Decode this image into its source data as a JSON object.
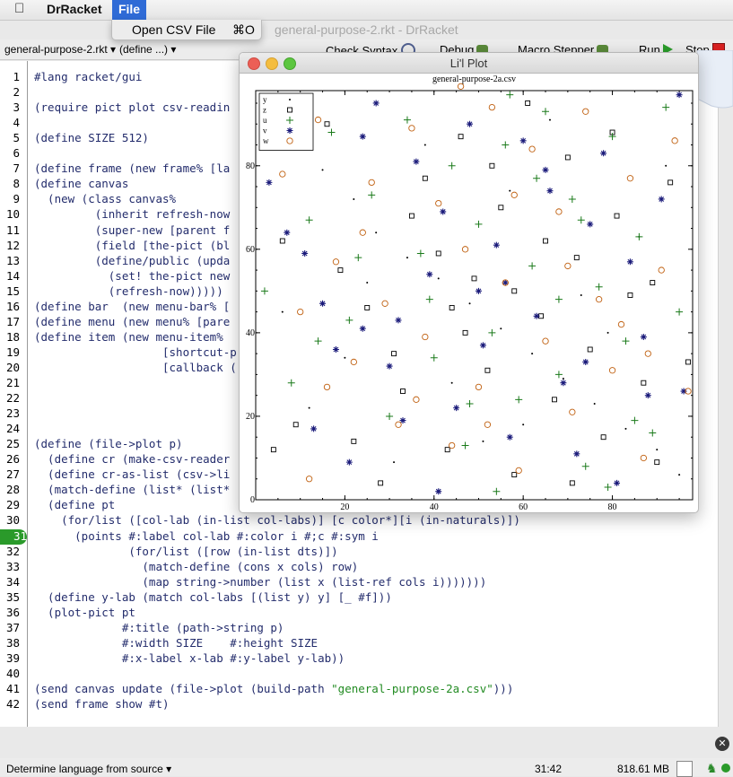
{
  "menubar": {
    "apple_icon": "apple-logo-icon",
    "app_name": "DrRacket",
    "file_menu": "File"
  },
  "dropdown": {
    "item_label": "Open CSV File",
    "shortcut": "⌘O"
  },
  "window": {
    "title": "general-purpose-2.rkt - DrRacket"
  },
  "toolbar": {
    "file_selector": "general-purpose-2.rkt ▾",
    "define_selector": "(define ...) ▾",
    "check_syntax": "Check Syntax",
    "debug": "Debug",
    "macro_stepper": "Macro Stepper",
    "run": "Run",
    "stop": "Stop"
  },
  "editor": {
    "active_line": 31,
    "lines": [
      "#lang racket/gui",
      "",
      "(require pict plot csv-readin",
      "",
      "(define SIZE 512)",
      "",
      "(define frame (new frame% [la",
      "(define canvas",
      "  (new (class canvas%",
      "         (inherit refresh-now",
      "         (super-new [parent f",
      "         (field [the-pict (bl",
      "         (define/public (upda",
      "           (set! the-pict new",
      "           (refresh-now)))))",
      "(define bar  (new menu-bar% [",
      "(define menu (new menu% [pare",
      "(define item (new menu-item%",
      "                   [shortcut-p",
      "                   [callback (",
      "",
      "",
      "",
      "",
      "(define (file->plot p)",
      "  (define cr (make-csv-reader",
      "  (define cr-as-list (csv->li",
      "  (match-define (list* (list*",
      "  (define pt",
      "    (for/list ([col-lab (in-list col-labs)] [c color*][i (in-naturals)])",
      "      (points #:label col-lab #:color i #;c #:sym i",
      "              (for/list ([row (in-list dts)])",
      "                (match-define (cons x cols) row)",
      "                (map string->number (list x (list-ref cols i)))))))",
      "  (define y-lab (match col-labs [(list y) y] [_ #f]))",
      "  (plot-pict pt",
      "             #:title (path->string p)",
      "             #:width SIZE    #:height SIZE",
      "             #:x-label x-lab #:y-label y-lab))",
      "",
      "(send canvas update (file->plot (build-path \"general-purpose-2a.csv\")))",
      "(send frame show #t)"
    ]
  },
  "plot_window": {
    "title": "Li'l Plot",
    "chart_data": {
      "type": "scatter",
      "title": "general-purpose-2a.csv",
      "xlabel": "",
      "ylabel": "",
      "xlim": [
        0,
        98
      ],
      "ylim": [
        0,
        98
      ],
      "x_ticks": [
        "20",
        "40",
        "60",
        "80"
      ],
      "y_ticks": [
        "0",
        "20",
        "40",
        "60",
        "80"
      ],
      "legend_position": "top-left",
      "series": [
        {
          "name": "y",
          "symbol": "dot",
          "color": "#000000",
          "points": [
            [
              3,
              88
            ],
            [
              9,
              85
            ],
            [
              15,
              79
            ],
            [
              22,
              72
            ],
            [
              27,
              64
            ],
            [
              34,
              58
            ],
            [
              41,
              53
            ],
            [
              48,
              47
            ],
            [
              55,
              41
            ],
            [
              62,
              35
            ],
            [
              69,
              29
            ],
            [
              76,
              23
            ],
            [
              83,
              17
            ],
            [
              90,
              12
            ],
            [
              95,
              6
            ],
            [
              12,
              22
            ],
            [
              20,
              34
            ],
            [
              31,
              9
            ],
            [
              44,
              28
            ],
            [
              57,
              74
            ],
            [
              66,
              91
            ],
            [
              73,
              49
            ],
            [
              86,
              63
            ],
            [
              38,
              85
            ],
            [
              51,
              14
            ],
            [
              79,
              40
            ],
            [
              92,
              80
            ],
            [
              6,
              45
            ],
            [
              25,
              52
            ],
            [
              60,
              18
            ]
          ]
        },
        {
          "name": "z",
          "symbol": "square",
          "color": "#000000",
          "points": [
            [
              6,
              62
            ],
            [
              9,
              18
            ],
            [
              19,
              55
            ],
            [
              25,
              46
            ],
            [
              31,
              35
            ],
            [
              33,
              26
            ],
            [
              38,
              77
            ],
            [
              41,
              59
            ],
            [
              43,
              12
            ],
            [
              46,
              87
            ],
            [
              49,
              53
            ],
            [
              52,
              31
            ],
            [
              55,
              70
            ],
            [
              58,
              6
            ],
            [
              61,
              95
            ],
            [
              64,
              44
            ],
            [
              67,
              24
            ],
            [
              70,
              82
            ],
            [
              72,
              58
            ],
            [
              75,
              36
            ],
            [
              78,
              15
            ],
            [
              81,
              68
            ],
            [
              84,
              49
            ],
            [
              87,
              28
            ],
            [
              90,
              9
            ],
            [
              93,
              76
            ],
            [
              28,
              4
            ],
            [
              35,
              68
            ],
            [
              47,
              40
            ],
            [
              53,
              80
            ],
            [
              65,
              62
            ],
            [
              16,
              90
            ],
            [
              22,
              14
            ],
            [
              80,
              88
            ],
            [
              89,
              52
            ],
            [
              97,
              33
            ],
            [
              4,
              12
            ],
            [
              44,
              46
            ],
            [
              58,
              50
            ],
            [
              71,
              4
            ]
          ]
        },
        {
          "name": "u",
          "symbol": "plus",
          "color": "#1a7a1a",
          "points": [
            [
              2,
              50
            ],
            [
              8,
              28
            ],
            [
              12,
              67
            ],
            [
              17,
              88
            ],
            [
              21,
              43
            ],
            [
              26,
              73
            ],
            [
              30,
              20
            ],
            [
              34,
              91
            ],
            [
              37,
              59
            ],
            [
              40,
              34
            ],
            [
              44,
              80
            ],
            [
              47,
              13
            ],
            [
              50,
              66
            ],
            [
              53,
              40
            ],
            [
              56,
              85
            ],
            [
              59,
              24
            ],
            [
              62,
              56
            ],
            [
              65,
              93
            ],
            [
              68,
              30
            ],
            [
              71,
              72
            ],
            [
              74,
              8
            ],
            [
              77,
              51
            ],
            [
              80,
              87
            ],
            [
              83,
              38
            ],
            [
              86,
              63
            ],
            [
              89,
              16
            ],
            [
              92,
              94
            ],
            [
              95,
              45
            ],
            [
              23,
              58
            ],
            [
              48,
              23
            ],
            [
              63,
              77
            ],
            [
              79,
              3
            ],
            [
              14,
              38
            ],
            [
              39,
              48
            ],
            [
              57,
              97
            ],
            [
              73,
              67
            ],
            [
              11,
              92
            ],
            [
              85,
              19
            ],
            [
              54,
              2
            ],
            [
              68,
              48
            ]
          ]
        },
        {
          "name": "v",
          "symbol": "asterisk",
          "color": "#1a1a7a",
          "points": [
            [
              3,
              76
            ],
            [
              7,
              64
            ],
            [
              11,
              59
            ],
            [
              15,
              47
            ],
            [
              18,
              36
            ],
            [
              21,
              9
            ],
            [
              24,
              41
            ],
            [
              27,
              95
            ],
            [
              30,
              32
            ],
            [
              33,
              19
            ],
            [
              36,
              81
            ],
            [
              39,
              54
            ],
            [
              42,
              69
            ],
            [
              45,
              22
            ],
            [
              48,
              90
            ],
            [
              51,
              37
            ],
            [
              54,
              61
            ],
            [
              57,
              15
            ],
            [
              60,
              86
            ],
            [
              63,
              44
            ],
            [
              66,
              74
            ],
            [
              69,
              28
            ],
            [
              72,
              11
            ],
            [
              75,
              66
            ],
            [
              78,
              83
            ],
            [
              81,
              4
            ],
            [
              84,
              57
            ],
            [
              87,
              39
            ],
            [
              91,
              72
            ],
            [
              95,
              97
            ],
            [
              32,
              43
            ],
            [
              56,
              52
            ],
            [
              74,
              33
            ],
            [
              13,
              17
            ],
            [
              88,
              25
            ],
            [
              41,
              2
            ],
            [
              65,
              79
            ],
            [
              24,
              87
            ],
            [
              50,
              50
            ],
            [
              96,
              26
            ]
          ]
        },
        {
          "name": "w",
          "symbol": "circle",
          "color": "#c06010",
          "points": [
            [
              2,
              87
            ],
            [
              6,
              78
            ],
            [
              10,
              45
            ],
            [
              14,
              91
            ],
            [
              18,
              57
            ],
            [
              22,
              33
            ],
            [
              26,
              76
            ],
            [
              29,
              47
            ],
            [
              32,
              18
            ],
            [
              35,
              89
            ],
            [
              38,
              39
            ],
            [
              41,
              71
            ],
            [
              44,
              13
            ],
            [
              47,
              60
            ],
            [
              50,
              27
            ],
            [
              53,
              94
            ],
            [
              56,
              52
            ],
            [
              59,
              7
            ],
            [
              62,
              84
            ],
            [
              65,
              38
            ],
            [
              68,
              69
            ],
            [
              71,
              21
            ],
            [
              74,
              93
            ],
            [
              77,
              48
            ],
            [
              80,
              31
            ],
            [
              84,
              77
            ],
            [
              87,
              10
            ],
            [
              91,
              55
            ],
            [
              94,
              86
            ],
            [
              97,
              26
            ],
            [
              12,
              5
            ],
            [
              24,
              64
            ],
            [
              36,
              24
            ],
            [
              58,
              73
            ],
            [
              70,
              56
            ],
            [
              82,
              42
            ],
            [
              46,
              99
            ],
            [
              16,
              27
            ],
            [
              88,
              35
            ],
            [
              52,
              18
            ]
          ]
        }
      ]
    }
  },
  "statusbar": {
    "language": "Determine language from source ▾",
    "position": "31:42",
    "memory": "818.61 MB"
  }
}
